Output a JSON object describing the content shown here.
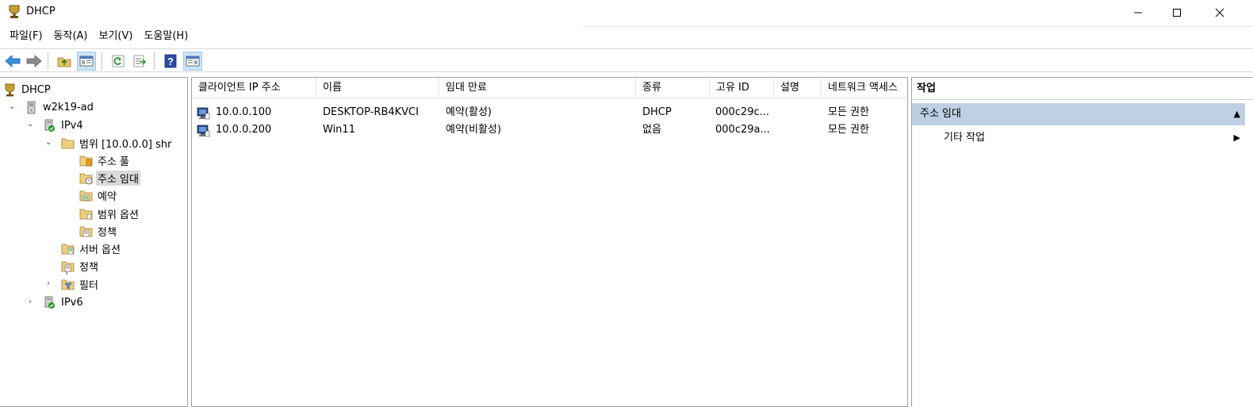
{
  "window": {
    "title": "DHCP"
  },
  "menu": [
    {
      "label": "파일(F)"
    },
    {
      "label": "동작(A)"
    },
    {
      "label": "보기(V)"
    },
    {
      "label": "도움말(H)"
    }
  ],
  "toolbar": {
    "buttons": [
      "back-icon",
      "forward-icon",
      "up-folder-icon",
      "show-hide-tree-icon",
      "refresh-icon",
      "export-list-icon",
      "help-icon",
      "show-hide-action-pane-icon"
    ]
  },
  "tree": {
    "items": [
      {
        "label": "DHCP",
        "icon": "dhcp-root-icon"
      },
      {
        "label": "w2k19-ad",
        "icon": "server-icon"
      },
      {
        "label": "IPv4",
        "icon": "ipv4-icon"
      },
      {
        "label": "범위 [10.0.0.0] shr",
        "icon": "scope-folder-icon"
      },
      {
        "label": "주소 풀",
        "icon": "address-pool-icon"
      },
      {
        "label": "주소 임대",
        "icon": "address-lease-icon"
      },
      {
        "label": "예약",
        "icon": "reservation-icon"
      },
      {
        "label": "범위 옵션",
        "icon": "scope-options-icon"
      },
      {
        "label": "정책",
        "icon": "policy-icon"
      },
      {
        "label": "서버 옵션",
        "icon": "server-options-icon"
      },
      {
        "label": "정책",
        "icon": "policy-icon"
      },
      {
        "label": "필터",
        "icon": "filter-icon"
      },
      {
        "label": "IPv6",
        "icon": "ipv6-icon"
      }
    ]
  },
  "list": {
    "columns": [
      "클라이언트 IP 주소",
      "이름",
      "임대 만료",
      "종류",
      "고유 ID",
      "설명",
      "네트워크 액세스"
    ],
    "rows": [
      {
        "ip": "10.0.0.100",
        "name": "DESKTOP-RB4KVCI",
        "expiry": "예약(활성)",
        "type": "DHCP",
        "uid": "000c29c...",
        "desc": "",
        "nap": "모든 권한"
      },
      {
        "ip": "10.0.0.200",
        "name": "Win11",
        "expiry": "예약(비활성)",
        "type": "없음",
        "uid": "000c29a...",
        "desc": "",
        "nap": "모든 권한"
      }
    ]
  },
  "actions": {
    "title": "작업",
    "section": "주소 임대",
    "item": "기타 작업"
  },
  "colors": {
    "selection": "#d9d9d9",
    "action_section_bg": "#bdd0e4",
    "toolbar_pressed": "#cce4f7"
  }
}
